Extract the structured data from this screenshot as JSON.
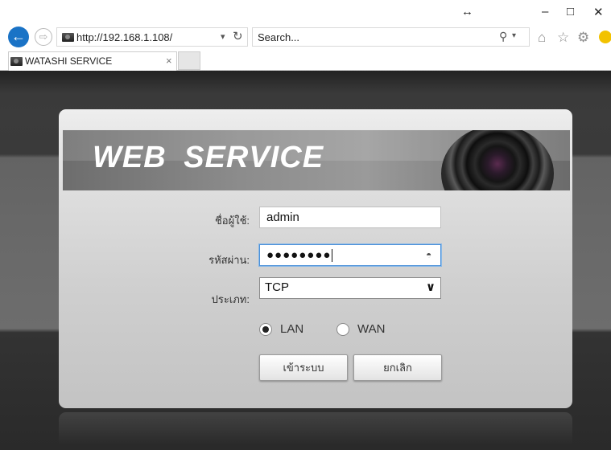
{
  "browser": {
    "resize_glyph": "↔",
    "win_controls": {
      "minimize": "–",
      "restore": "□",
      "close": "✕"
    },
    "back_glyph": "←",
    "forward_glyph": "⇨",
    "url": "http://192.168.1.108/",
    "url_dropdown": "▾",
    "refresh_glyph": "↻",
    "search_placeholder": "Search...",
    "search_glyph": "⚲",
    "search_dropdown": "▾",
    "toolbar_icons": {
      "home": "⌂",
      "favorites": "☆",
      "settings": "⚙"
    },
    "tab_title": "WATASHI SERVICE",
    "tab_close": "×"
  },
  "login": {
    "banner_title": "WEB SERVICE",
    "username_label": "ชื่อผู้ใช้:",
    "username_value": "admin",
    "password_label": "รหัสผ่าน:",
    "password_value": "●●●●●●●●",
    "eye_glyph": "◓",
    "type_label": "ประเภท:",
    "type_value": "TCP",
    "select_arrow": "∨",
    "network_options": [
      {
        "label": "LAN",
        "selected": true
      },
      {
        "label": "WAN",
        "selected": false
      }
    ],
    "login_button": "เข้าระบบ",
    "cancel_button": "ยกเลิก"
  },
  "colors": {
    "back_button": "#1a73c6",
    "focus_border": "#4a90d9"
  }
}
